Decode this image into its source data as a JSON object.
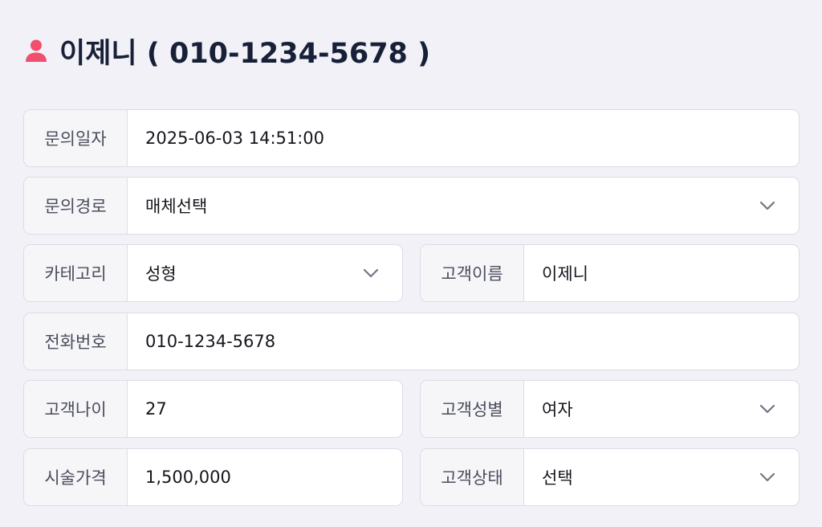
{
  "header": {
    "title": "이제니 ( 010-1234-5678 )",
    "icon": "person-icon",
    "icon_color": "#f0506e"
  },
  "form": {
    "inquiry_date": {
      "label": "문의일자",
      "value": "2025-06-03 14:51:00"
    },
    "inquiry_channel": {
      "label": "문의경로",
      "value": "매체선택",
      "icon": "chevron-down-icon"
    },
    "category": {
      "label": "카테고리",
      "value": "성형",
      "icon": "chevron-down-icon"
    },
    "customer_name": {
      "label": "고객이름",
      "value": "이제니"
    },
    "phone": {
      "label": "전화번호",
      "value": "010-1234-5678"
    },
    "customer_age": {
      "label": "고객나이",
      "value": "27"
    },
    "customer_gender": {
      "label": "고객성별",
      "value": "여자",
      "icon": "chevron-down-icon"
    },
    "procedure_price": {
      "label": "시술가격",
      "value": "1,500,000"
    },
    "customer_status": {
      "label": "고객상태",
      "value": "선택",
      "icon": "chevron-down-icon"
    }
  }
}
